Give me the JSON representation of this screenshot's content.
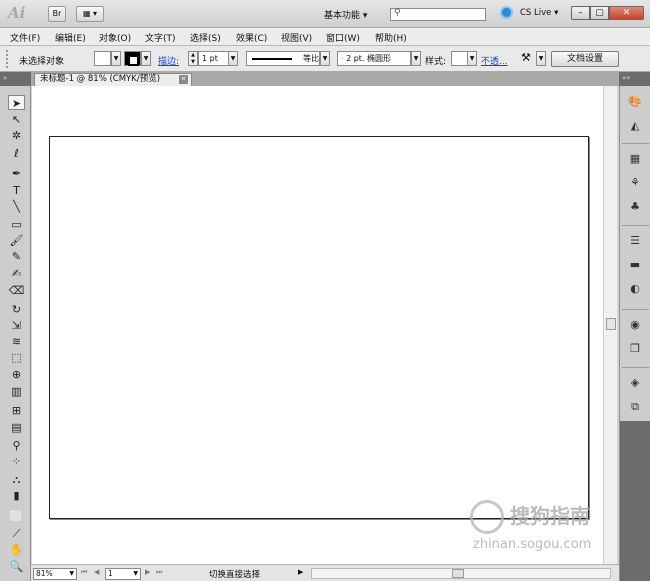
{
  "titlebar": {
    "logo": "Ai",
    "br_label": "Br",
    "arrange_label": "▦ ▾",
    "workspace": "基本功能 ▾",
    "search_placeholder": "",
    "cslive": "CS Live ▾",
    "minimize": "–",
    "maximize": "▢",
    "close": "✕"
  },
  "menu": [
    "文件(F)",
    "编辑(E)",
    "对象(O)",
    "文字(T)",
    "选择(S)",
    "效果(C)",
    "视图(V)",
    "窗口(W)",
    "帮助(H)"
  ],
  "control": {
    "no_selection": "未选择对象",
    "stroke_label": "描边:",
    "stroke_weight": "1 pt",
    "profile": "等比",
    "brush": "2 pt. 椭圆形",
    "style_label": "样式:",
    "opacity_link": "不透...",
    "doc_setup": "文档设置"
  },
  "tabs": {
    "panel_left": "»",
    "panel_right": "««",
    "document_tab": "未标题-1 @ 81% (CMYK/预览)",
    "close_glyph": "✕"
  },
  "tools": [
    {
      "name": "selection-tool-icon",
      "glyph": "➤"
    },
    {
      "name": "direct-selection-tool-icon",
      "glyph": "↖"
    },
    {
      "name": "magic-wand-tool-icon",
      "glyph": "✲"
    },
    {
      "name": "lasso-tool-icon",
      "glyph": "ℓ"
    },
    {
      "name": "pen-tool-icon",
      "glyph": "✒"
    },
    {
      "name": "type-tool-icon",
      "glyph": "T"
    },
    {
      "name": "line-tool-icon",
      "glyph": "╲"
    },
    {
      "name": "rectangle-tool-icon",
      "glyph": "▭"
    },
    {
      "name": "paintbrush-tool-icon",
      "glyph": "🖌"
    },
    {
      "name": "pencil-tool-icon",
      "glyph": "✎"
    },
    {
      "name": "blob-brush-tool-icon",
      "glyph": "✍"
    },
    {
      "name": "eraser-tool-icon",
      "glyph": "⌫"
    },
    {
      "name": "rotate-tool-icon",
      "glyph": "↻"
    },
    {
      "name": "scale-tool-icon",
      "glyph": "⇲"
    },
    {
      "name": "warp-tool-icon",
      "glyph": "≋"
    },
    {
      "name": "free-transform-tool-icon",
      "glyph": "⬚"
    },
    {
      "name": "shape-builder-tool-icon",
      "glyph": "⊕"
    },
    {
      "name": "perspective-grid-tool-icon",
      "glyph": "▥"
    },
    {
      "name": "mesh-tool-icon",
      "glyph": "⊞"
    },
    {
      "name": "gradient-tool-icon",
      "glyph": "▤"
    },
    {
      "name": "eyedropper-tool-icon",
      "glyph": "⚲"
    },
    {
      "name": "blend-tool-icon",
      "glyph": "⁘"
    },
    {
      "name": "symbol-sprayer-tool-icon",
      "glyph": "⛬"
    },
    {
      "name": "column-graph-tool-icon",
      "glyph": "▮"
    },
    {
      "name": "artboard-tool-icon",
      "glyph": "⬜"
    },
    {
      "name": "slice-tool-icon",
      "glyph": "⟋"
    },
    {
      "name": "hand-tool-icon",
      "glyph": "✋"
    },
    {
      "name": "zoom-tool-icon",
      "glyph": "🔍"
    }
  ],
  "dock": [
    {
      "name": "color-panel-icon",
      "glyph": "🎨"
    },
    {
      "name": "color-guide-panel-icon",
      "glyph": "◭"
    },
    {
      "name": "swatches-panel-icon",
      "glyph": "▦"
    },
    {
      "name": "brushes-panel-icon",
      "glyph": "⚘"
    },
    {
      "name": "symbols-panel-icon",
      "glyph": "♣"
    },
    {
      "name": "stroke-panel-icon",
      "glyph": "☰"
    },
    {
      "name": "gradient-panel-icon",
      "glyph": "▬"
    },
    {
      "name": "transparency-panel-icon",
      "glyph": "◐"
    },
    {
      "name": "appearance-panel-icon",
      "glyph": "◉"
    },
    {
      "name": "graphic-styles-panel-icon",
      "glyph": "❐"
    },
    {
      "name": "layers-panel-icon",
      "glyph": "◈"
    },
    {
      "name": "artboards-panel-icon",
      "glyph": "⧉"
    }
  ],
  "status": {
    "zoom": "81%",
    "artboard_number": "1",
    "status_text": "切换直接选择"
  },
  "watermark": {
    "title": "搜狗指南",
    "url": "zhinan.sogou.com"
  }
}
